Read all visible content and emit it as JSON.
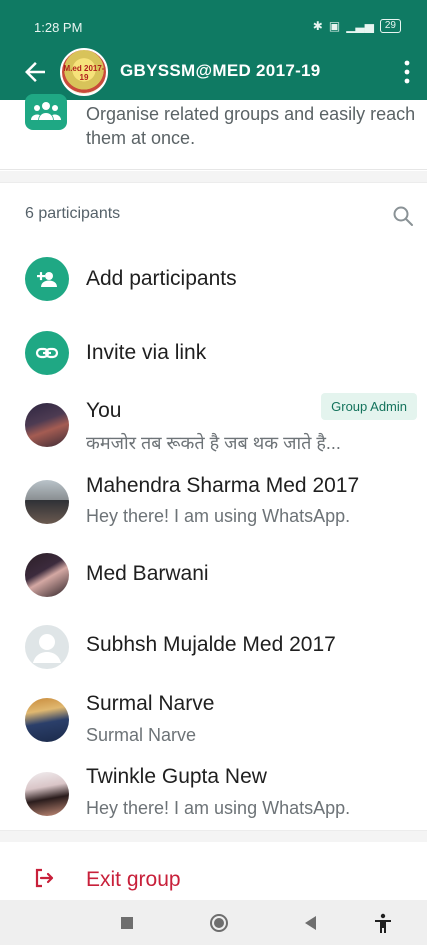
{
  "status_bar": {
    "time": "1:28 PM",
    "icons": [
      "bluetooth-icon",
      "notification-icon",
      "signal-icon",
      "battery-icon"
    ],
    "battery": "29"
  },
  "app_bar": {
    "title": "GBYSSM@MED 2017-19",
    "avatar_text": "M.ed 2017-19"
  },
  "community": {
    "text": "Organise related groups and easily reach them at once."
  },
  "participants": {
    "count_label": "6 participants"
  },
  "actions": [
    {
      "label": "Add participants",
      "icon": "add-person-icon"
    },
    {
      "label": "Invite via link",
      "icon": "link-icon"
    }
  ],
  "members": [
    {
      "name": "You",
      "about": "कमजोर तब रूकते है जब थक जाते है...",
      "badge": "Group Admin"
    },
    {
      "name": "Mahendra Sharma Med 2017",
      "about": "Hey there! I am using WhatsApp."
    },
    {
      "name": "Med Barwani",
      "about": ""
    },
    {
      "name": "Subhsh Mujalde Med 2017",
      "about": ""
    },
    {
      "name": "Surmal Narve",
      "about": "Surmal Narve"
    },
    {
      "name": "Twinkle Gupta New",
      "about": "Hey there! I am using WhatsApp."
    }
  ],
  "exit": {
    "label": "Exit group"
  },
  "colors": {
    "header": "#0f7a63",
    "accent": "#1fa884",
    "danger": "#c8203a",
    "badge_bg": "#e4f4ee"
  }
}
